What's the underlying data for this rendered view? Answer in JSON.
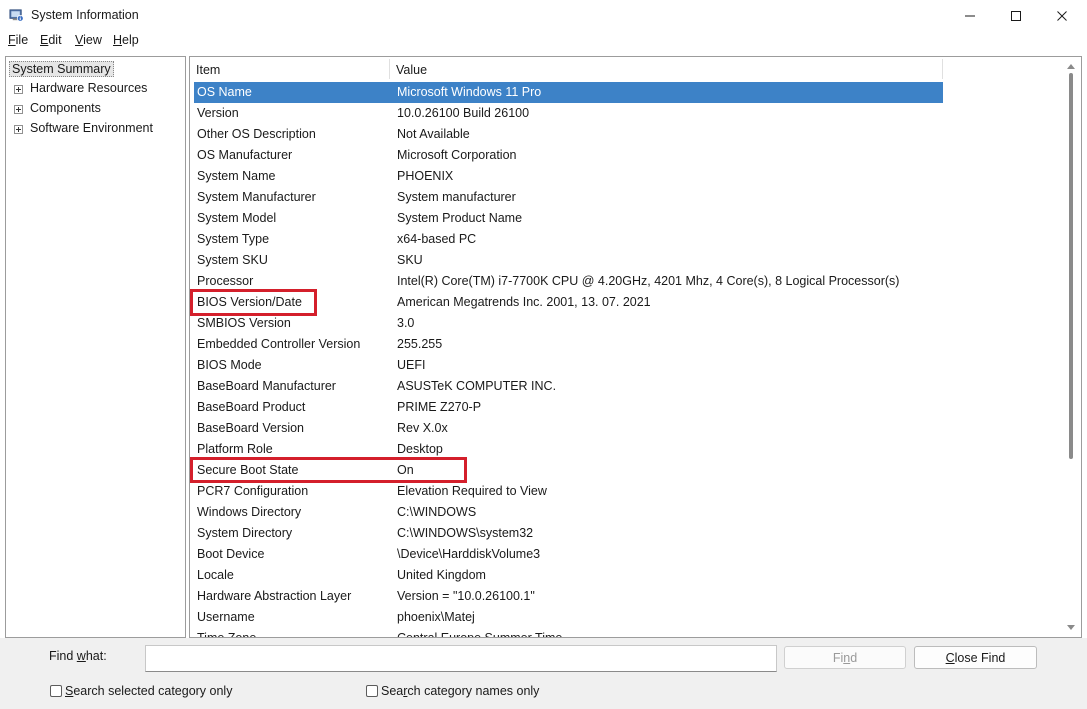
{
  "window": {
    "title": "System Information"
  },
  "menu": [
    {
      "key": "F",
      "rest": "ile"
    },
    {
      "key": "E",
      "rest": "dit"
    },
    {
      "key": "V",
      "rest": "iew"
    },
    {
      "key": "H",
      "rest": "elp"
    }
  ],
  "tree": {
    "items": [
      {
        "label": "System Summary",
        "expandable": false,
        "selected": true
      },
      {
        "label": "Hardware Resources",
        "expandable": true
      },
      {
        "label": "Components",
        "expandable": true
      },
      {
        "label": "Software Environment",
        "expandable": true
      }
    ]
  },
  "table": {
    "headers": {
      "item": "Item",
      "value": "Value"
    },
    "rows": [
      {
        "item": "OS Name",
        "value": "Microsoft Windows 11 Pro",
        "selected": true
      },
      {
        "item": "Version",
        "value": "10.0.26100 Build 26100"
      },
      {
        "item": "Other OS Description",
        "value": "Not Available"
      },
      {
        "item": "OS Manufacturer",
        "value": "Microsoft Corporation"
      },
      {
        "item": "System Name",
        "value": "PHOENIX"
      },
      {
        "item": "System Manufacturer",
        "value": "System manufacturer"
      },
      {
        "item": "System Model",
        "value": "System Product Name"
      },
      {
        "item": "System Type",
        "value": "x64-based PC"
      },
      {
        "item": "System SKU",
        "value": "SKU"
      },
      {
        "item": "Processor",
        "value": "Intel(R) Core(TM) i7-7700K CPU @ 4.20GHz, 4201 Mhz, 4 Core(s), 8 Logical Processor(s)"
      },
      {
        "item": "BIOS Version/Date",
        "value": "American Megatrends Inc. 2001, 13. 07. 2021"
      },
      {
        "item": "SMBIOS Version",
        "value": "3.0"
      },
      {
        "item": "Embedded Controller Version",
        "value": "255.255"
      },
      {
        "item": "BIOS Mode",
        "value": "UEFI"
      },
      {
        "item": "BaseBoard Manufacturer",
        "value": "ASUSTeK COMPUTER INC."
      },
      {
        "item": "BaseBoard Product",
        "value": "PRIME Z270-P"
      },
      {
        "item": "BaseBoard Version",
        "value": "Rev X.0x"
      },
      {
        "item": "Platform Role",
        "value": "Desktop"
      },
      {
        "item": "Secure Boot State",
        "value": "On"
      },
      {
        "item": "PCR7 Configuration",
        "value": "Elevation Required to View"
      },
      {
        "item": "Windows Directory",
        "value": "C:\\WINDOWS"
      },
      {
        "item": "System Directory",
        "value": "C:\\WINDOWS\\system32"
      },
      {
        "item": "Boot Device",
        "value": "\\Device\\HarddiskVolume3"
      },
      {
        "item": "Locale",
        "value": "United Kingdom"
      },
      {
        "item": "Hardware Abstraction Layer",
        "value": "Version = \"10.0.26100.1\""
      },
      {
        "item": "Username",
        "value": "phoenix\\Matej"
      },
      {
        "item": "Time Zone",
        "value": "Central Europe Summer Time"
      }
    ]
  },
  "find": {
    "label_pre": "Find ",
    "label_key": "w",
    "label_post": "hat:",
    "input_value": "",
    "find_button": {
      "pre": "Fi",
      "key": "n",
      "post": "d"
    },
    "close_button": {
      "pre": "",
      "key": "C",
      "post": "lose Find"
    },
    "checkbox_selected": {
      "pre": "",
      "key": "S",
      "post": "earch selected category only",
      "checked": false
    },
    "checkbox_names": {
      "pre": "Sea",
      "key": "r",
      "post": "ch category names only",
      "checked": false
    }
  },
  "colors": {
    "selection": "#3d82c7",
    "annotation": "#d41f2b"
  }
}
